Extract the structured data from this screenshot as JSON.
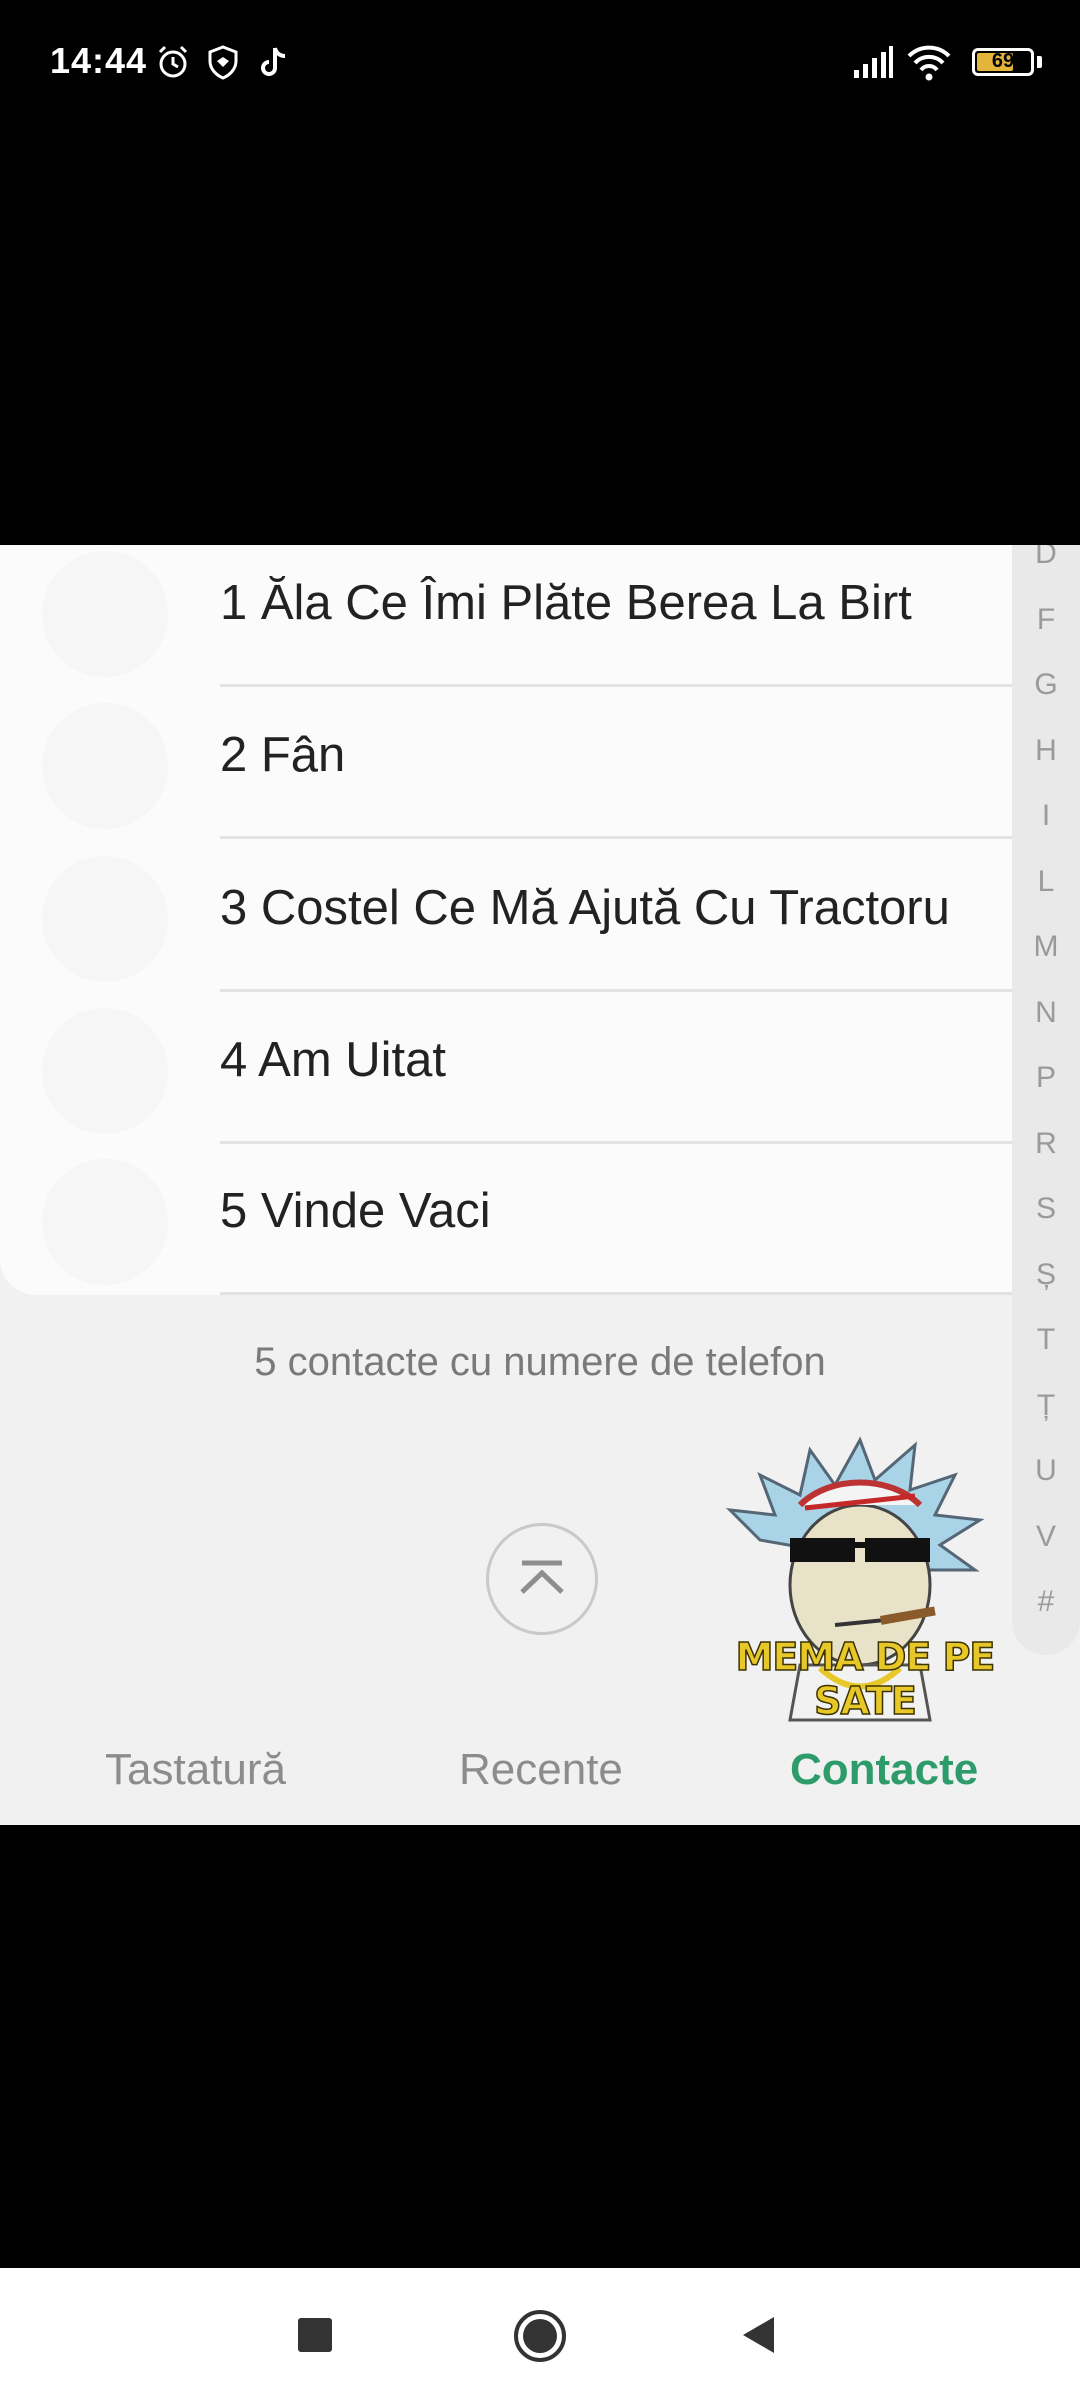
{
  "status_bar": {
    "time": "14:44",
    "battery_percent": 69,
    "battery_label": "69",
    "left_icons": [
      "alarm-icon",
      "shield-icon",
      "tiktok-icon"
    ],
    "right_icons": [
      "signal-icon",
      "wifi-icon",
      "battery-icon"
    ]
  },
  "contacts": {
    "items": [
      {
        "label": "1 Ăla Ce Îmi Plăte Berea La Birt"
      },
      {
        "label": "2 Fân"
      },
      {
        "label": "3 Costel Ce Mă Ajută Cu Tractoru"
      },
      {
        "label": "4 Am Uitat"
      },
      {
        "label": "5 Vinde Vaci"
      }
    ],
    "count_text": "5 contacte cu numere de telefon"
  },
  "index_letters": [
    "D",
    "F",
    "G",
    "H",
    "I",
    "L",
    "M",
    "N",
    "P",
    "R",
    "S",
    "Ș",
    "T",
    "Ț",
    "U",
    "V",
    "#"
  ],
  "watermark": {
    "text": "MEMA DE PE SATE"
  },
  "tabs": [
    {
      "label": "Tastatură",
      "active": false
    },
    {
      "label": "Recente",
      "active": false
    },
    {
      "label": "Contacte",
      "active": true
    }
  ],
  "colors": {
    "accent": "#2e9c6a",
    "battery": "#e5b43a"
  }
}
